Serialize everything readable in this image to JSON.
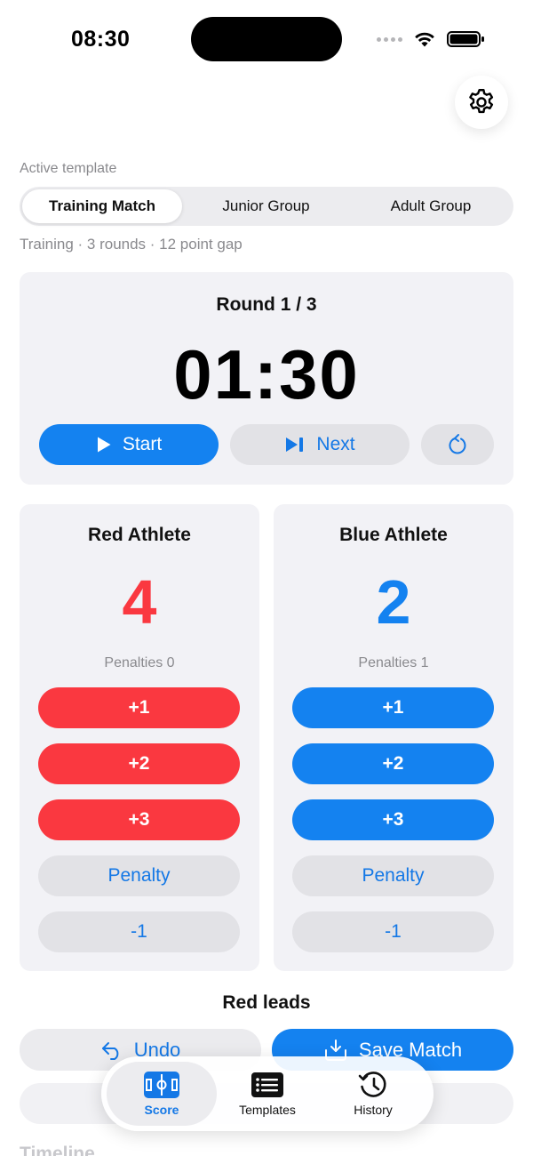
{
  "status_bar": {
    "time": "08:30"
  },
  "template": {
    "label": "Active template",
    "options": [
      "Training Match",
      "Junior Group",
      "Adult Group"
    ],
    "selected": "Training Match",
    "info": "Training · 3 rounds · 12 point gap"
  },
  "timer": {
    "round": "Round 1 / 3",
    "clock": "01:30",
    "start_label": "Start",
    "next_label": "Next"
  },
  "red": {
    "name": "Red Athlete",
    "score": "4",
    "penalties": "Penalties 0",
    "buttons": [
      "+1",
      "+2",
      "+3",
      "Penalty",
      "-1"
    ],
    "color": "#fa3840"
  },
  "blue": {
    "name": "Blue Athlete",
    "score": "2",
    "penalties": "Penalties 1",
    "buttons": [
      "+1",
      "+2",
      "+3",
      "Penalty",
      "-1"
    ],
    "color": "#1482f0"
  },
  "lead_text": "Red leads",
  "actions": {
    "undo_label": "Undo",
    "save_label": "Save Match"
  },
  "timeline_label": "Timeline",
  "tabs": [
    {
      "label": "Score",
      "icon": "field-icon"
    },
    {
      "label": "Templates",
      "icon": "list-icon"
    },
    {
      "label": "History",
      "icon": "history-icon"
    }
  ],
  "colors": {
    "accent": "#1482f0",
    "red": "#fa3840",
    "card": "#f2f2f6"
  }
}
